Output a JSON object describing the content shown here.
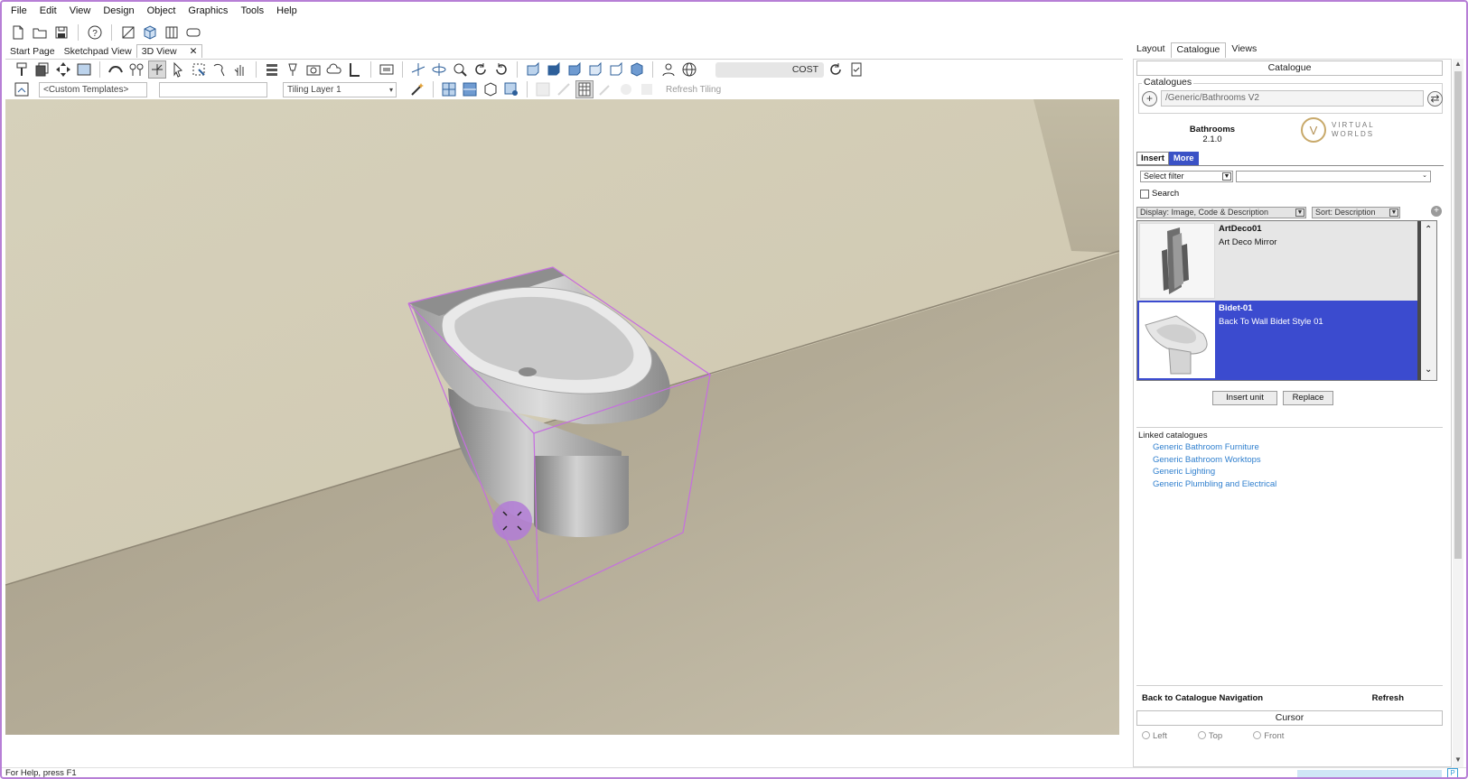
{
  "menu": [
    "File",
    "Edit",
    "View",
    "Design",
    "Object",
    "Graphics",
    "Tools",
    "Help"
  ],
  "doc_tabs": [
    {
      "label": "Start Page",
      "active": false
    },
    {
      "label": "Sketchpad View",
      "active": false
    },
    {
      "label": "3D View",
      "active": true
    }
  ],
  "doc_tab_close": "✕",
  "viewport_toolbar": {
    "cost_label": "COST",
    "template_combo": "<Custom Templates>",
    "tiling_layer": "Tiling Layer 1",
    "refresh_tiling": "Refresh Tiling"
  },
  "panel_tabs": [
    {
      "label": "Layout",
      "active": false
    },
    {
      "label": "Catalogue",
      "active": true
    },
    {
      "label": "Views",
      "active": false
    }
  ],
  "catalogue": {
    "section_title": "Catalogue",
    "group_label": "Catalogues",
    "path": "/Generic/Bathrooms V2",
    "name": "Bathrooms",
    "version": "2.1.0",
    "logo_letter": "V",
    "logo_text_1": "VIRTUAL",
    "logo_text_2": "WORLDS",
    "tab_insert": "Insert",
    "tab_more": "More",
    "filter": "Select filter",
    "search_label": "Search",
    "display": "Display: Image, Code & Description",
    "sort": "Sort: Description",
    "items": [
      {
        "code": "ArtDeco01",
        "description": "Art Deco Mirror",
        "selected": false
      },
      {
        "code": "Bidet-01",
        "description": "Back To Wall Bidet Style 01",
        "selected": true
      }
    ],
    "insert_button": "Insert unit",
    "replace_button": "Replace",
    "linked_head": "Linked catalogues",
    "linked": [
      "Generic Bathroom Furniture",
      "Generic Bathroom Worktops",
      "Generic Lighting",
      "Generic Plumbling and Electrical"
    ],
    "back_nav": "Back to Catalogue Navigation",
    "refresh": "Refresh"
  },
  "cursor": {
    "section_title": "Cursor",
    "options": [
      "Left",
      "Top",
      "Front"
    ]
  },
  "status": {
    "help": "For Help, press F1"
  },
  "colors": {
    "selection": "#3b4bcf",
    "bounding_box": "#c66ee0",
    "link": "#2f7fce",
    "frame": "#b77fd6"
  }
}
